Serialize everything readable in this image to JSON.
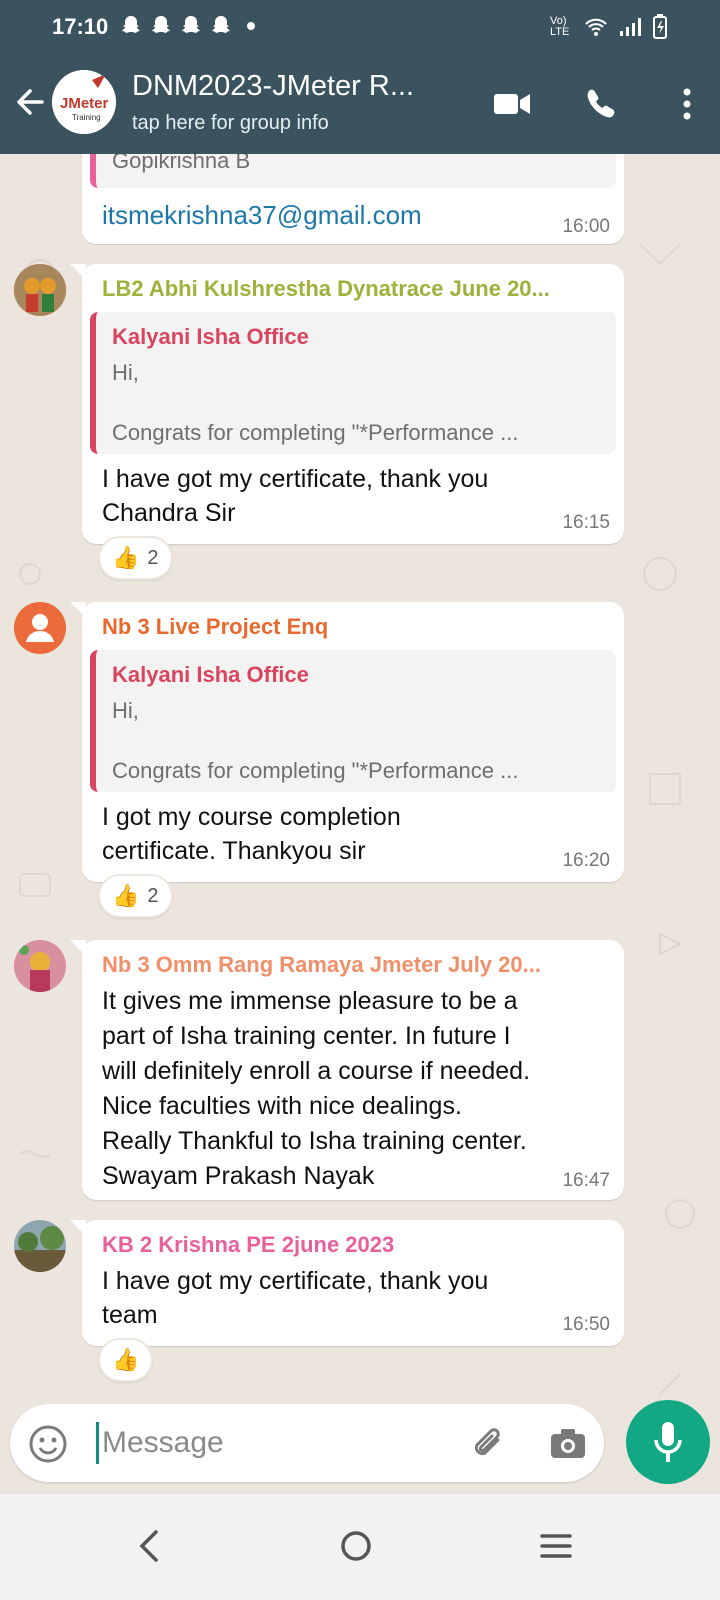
{
  "status_bar": {
    "time": "17:10",
    "notification_icons": [
      "snapchat-icon",
      "snapchat-icon",
      "snapchat-icon",
      "snapchat-icon",
      "dot-icon"
    ],
    "network_label": "Vo) LTE"
  },
  "header": {
    "group_name": "DNM2023-JMeter R...",
    "subtitle": "tap here for group info",
    "avatar_text_top": "JMeter",
    "avatar_text_bottom": "Training"
  },
  "messages": [
    {
      "quote_author": "Gopikrishna B",
      "text": "itsmekrishna37@gmail.com",
      "time": "16:00"
    },
    {
      "sender": "LB2 Abhi Kulshrestha Dynatrace June 20...",
      "sender_color": "#a0b03a",
      "quote_author": "Kalyani Isha Office",
      "quote_line1": "Hi,",
      "quote_line2": "Congrats for completing \"*Performance ...",
      "text_line1": "I have got my certificate, thank you",
      "text_line2": "Chandra Sir",
      "time": "16:15",
      "reaction_emoji": "👍",
      "reaction_count": "2"
    },
    {
      "sender": "Nb 3 Live Project Enq",
      "sender_color": "#e8692d",
      "quote_author": "Kalyani Isha Office",
      "quote_line1": "Hi,",
      "quote_line2": "Congrats for completing \"*Performance ...",
      "text_line1": "I got my course completion",
      "text_line2": "certificate. Thankyou sir",
      "time": "16:20",
      "reaction_emoji": "👍",
      "reaction_count": "2"
    },
    {
      "sender": "Nb 3 Omm Rang Ramaya Jmeter July 20...",
      "sender_color": "#f0906a",
      "lines": [
        "It gives me  immense pleasure to be a",
        "part of Isha training center. In future I",
        "will definitely enroll a course if needed.",
        "Nice faculties with nice dealings.",
        "Really Thankful to Isha training center.",
        "Swayam Prakash Nayak"
      ],
      "time": "16:47"
    },
    {
      "sender": "KB 2 Krishna PE 2june 2023",
      "sender_color": "#e8609a",
      "text_line1": "I have got my certificate, thank you",
      "text_line2": "team",
      "time": "16:50",
      "reaction_emoji": "👍"
    }
  ],
  "input": {
    "placeholder": "Message"
  },
  "colors": {
    "header_bg": "#3b535e",
    "chat_bg": "#ece5dd",
    "accent_green": "#13a884",
    "quote_red": "#d9455f",
    "link_blue": "#1d77a8"
  }
}
